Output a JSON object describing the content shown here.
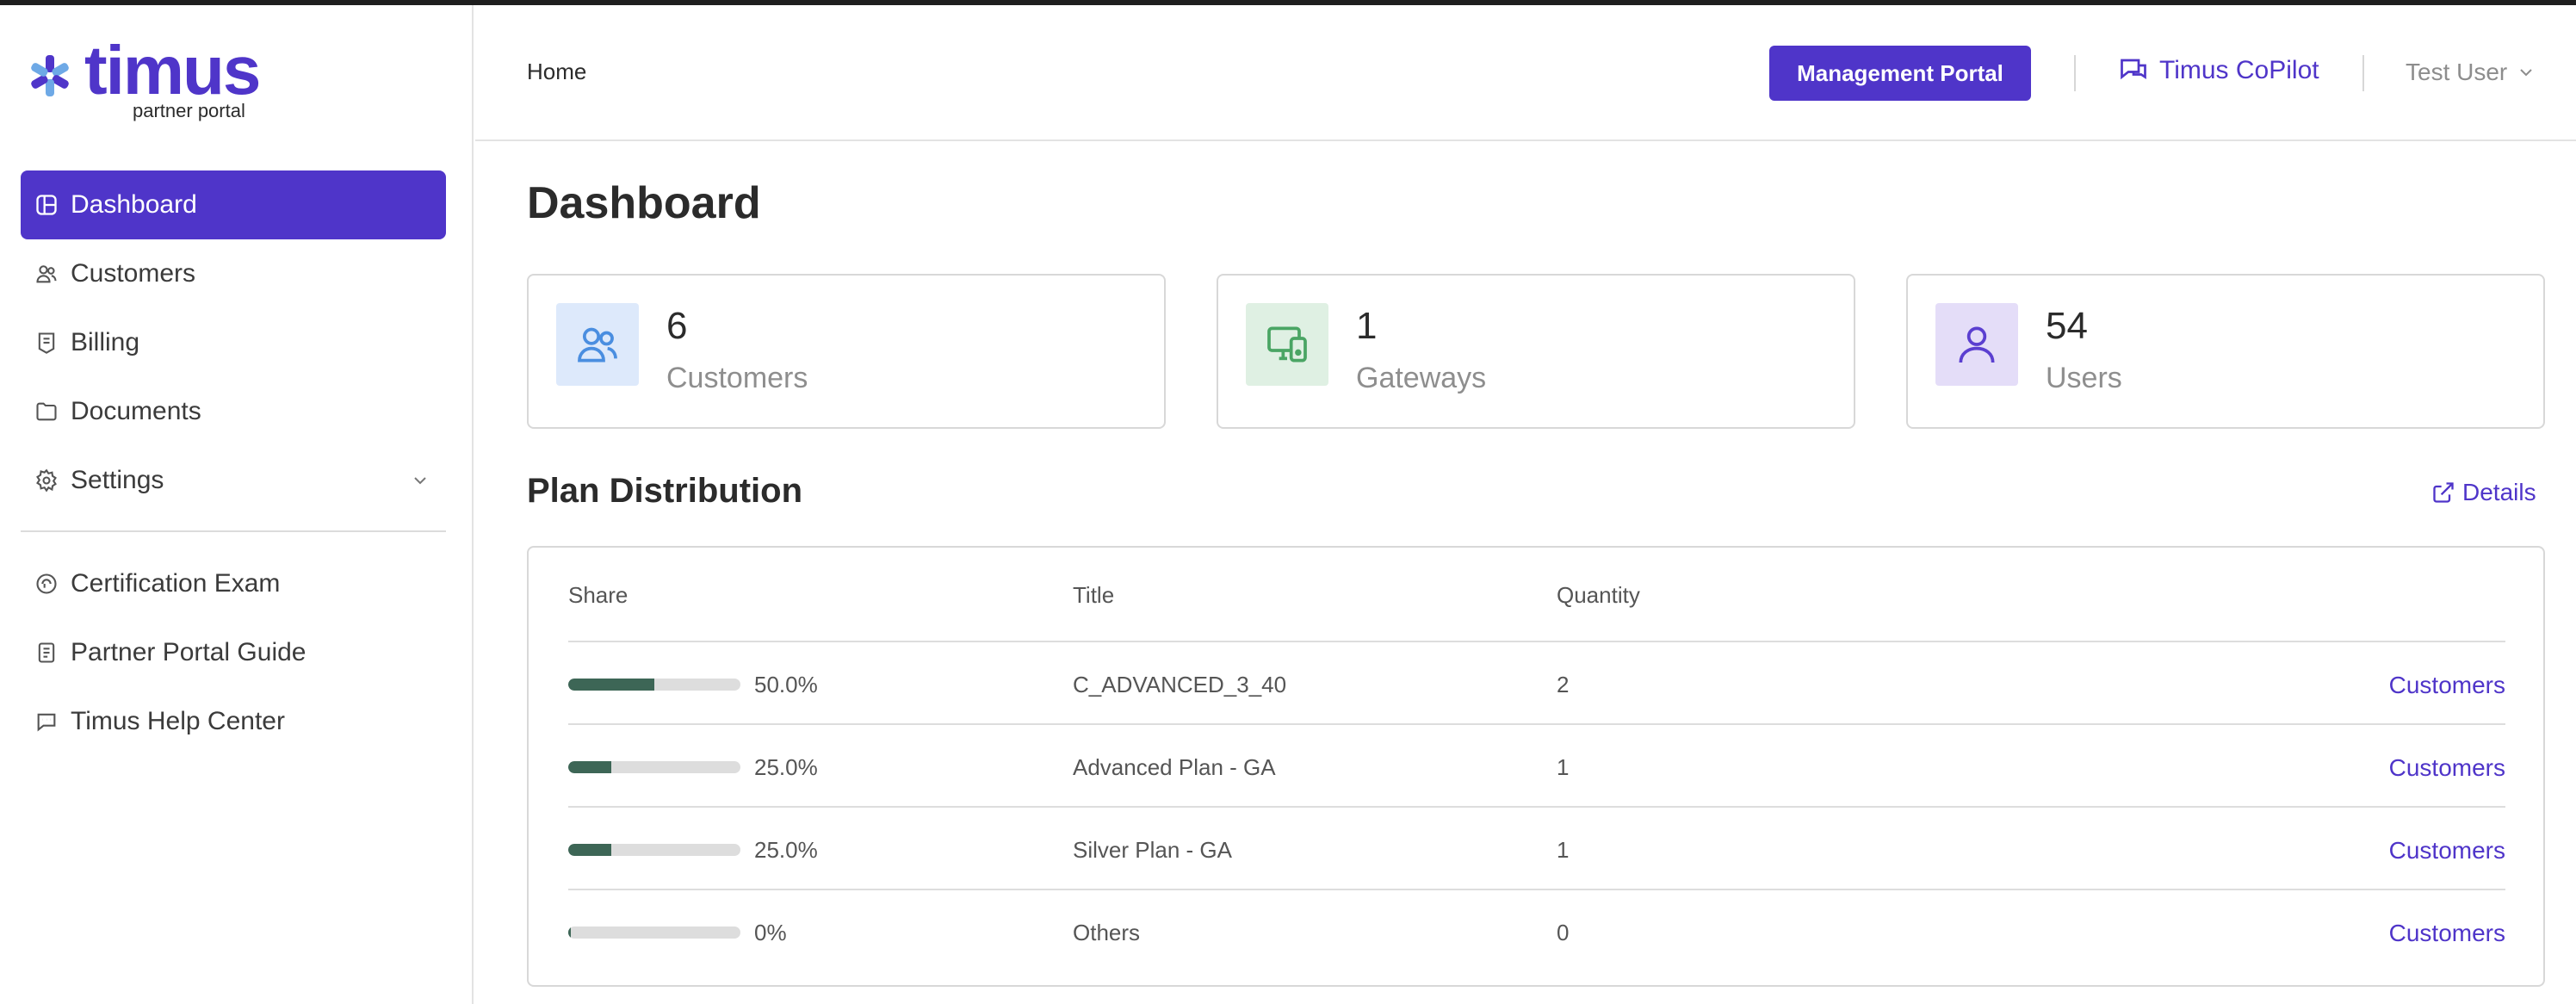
{
  "brand": {
    "name": "timus",
    "subtitle": "partner portal",
    "accent": "#4f35c9"
  },
  "sidebar": {
    "items": [
      {
        "label": "Dashboard",
        "icon": "dashboard-icon",
        "active": true
      },
      {
        "label": "Customers",
        "icon": "users-icon"
      },
      {
        "label": "Billing",
        "icon": "receipt-icon"
      },
      {
        "label": "Documents",
        "icon": "folder-icon"
      },
      {
        "label": "Settings",
        "icon": "gear-icon",
        "expandable": true
      }
    ],
    "secondary": [
      {
        "label": "Certification Exam",
        "icon": "certificate-icon"
      },
      {
        "label": "Partner Portal Guide",
        "icon": "book-icon"
      },
      {
        "label": "Timus Help Center",
        "icon": "chat-icon"
      }
    ]
  },
  "header": {
    "breadcrumb": "Home",
    "management_portal": "Management Portal",
    "copilot": "Timus CoPilot",
    "user": "Test User"
  },
  "main": {
    "title": "Dashboard",
    "stats": [
      {
        "value": "6",
        "label": "Customers",
        "icon": "users-icon",
        "bg": "#dde9fb",
        "fg": "#4a8ee0"
      },
      {
        "value": "1",
        "label": "Gateways",
        "icon": "gateway-device-icon",
        "bg": "#dff0e3",
        "fg": "#4aa564"
      },
      {
        "value": "54",
        "label": "Users",
        "icon": "user-icon",
        "bg": "#e4ddf8",
        "fg": "#5b3fd0"
      }
    ],
    "plan_distribution": {
      "title": "Plan Distribution",
      "details_label": "Details",
      "columns": [
        "Share",
        "Title",
        "Quantity"
      ],
      "rows": [
        {
          "share": 0.5,
          "share_label": "50.0%",
          "title": "C_ADVANCED_3_40",
          "quantity": "2",
          "link": "Customers"
        },
        {
          "share": 0.25,
          "share_label": "25.0%",
          "title": "Advanced Plan - GA",
          "quantity": "1",
          "link": "Customers"
        },
        {
          "share": 0.25,
          "share_label": "25.0%",
          "title": "Silver Plan - GA",
          "quantity": "1",
          "link": "Customers"
        },
        {
          "share": 0,
          "share_label": "0%",
          "title": "Others",
          "quantity": "0",
          "link": "Customers"
        }
      ]
    }
  }
}
